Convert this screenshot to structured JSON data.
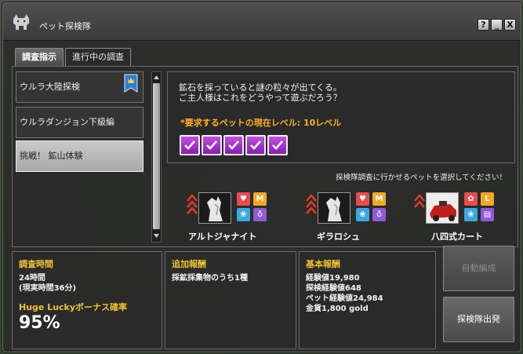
{
  "window": {
    "title": "ペット探検隊",
    "buttons": {
      "help": "?",
      "minimize": "_",
      "close": "X"
    }
  },
  "tabs": [
    {
      "label": "調査指示",
      "active": true
    },
    {
      "label": "進行中の調査",
      "active": false
    }
  ],
  "expeditions": [
    {
      "label": "ウルラ大陸探検",
      "selected": false,
      "has_badge": true
    },
    {
      "label": "ウルラダンジョン下級編",
      "selected": false,
      "has_badge": false
    },
    {
      "label": "挑戦！ 鉱山体験",
      "selected": true,
      "has_badge": false
    }
  ],
  "description": {
    "line1": "鉱石を採っていると謎の粒々が出てくる。",
    "line2": "ご主人様はこれをどうやって遊ぶだろう？",
    "requirement": "*要求するペットの現在レベル: 10レベル",
    "check_count": 5
  },
  "pet_instruction": "探検隊調査に行かせるペットを選択してください！",
  "pets": [
    {
      "name": "アルトジャナイト",
      "stats": [
        "heart",
        "M",
        "paw",
        "potion"
      ]
    },
    {
      "name": "ギラロシュ",
      "stats": [
        "heart",
        "M",
        "paw",
        "potion"
      ]
    },
    {
      "name": "八四式カート",
      "stats": [
        "gear",
        "L",
        "paw",
        "scroll"
      ]
    }
  ],
  "survey_time": {
    "header": "調査時間",
    "value": "24時間",
    "real": "(現実時間36分)",
    "bonus_header": "Huge Luckyボーナス確率",
    "bonus_value": "95%"
  },
  "additional_reward": {
    "header": "追加報酬",
    "value": "採鉱採集物のうち1種"
  },
  "base_reward": {
    "header": "基本報酬",
    "lines": [
      "経験値19,980",
      "探検経験値648",
      "ペット経験値24,984",
      "金貨1,800 gold"
    ]
  },
  "actions": {
    "auto_form": "自動編成",
    "depart": "探検隊出発"
  },
  "colors": {
    "accent_yellow": "#f2c230",
    "requirement_orange": "#ffb020",
    "check_purple": "#a43ad0"
  }
}
